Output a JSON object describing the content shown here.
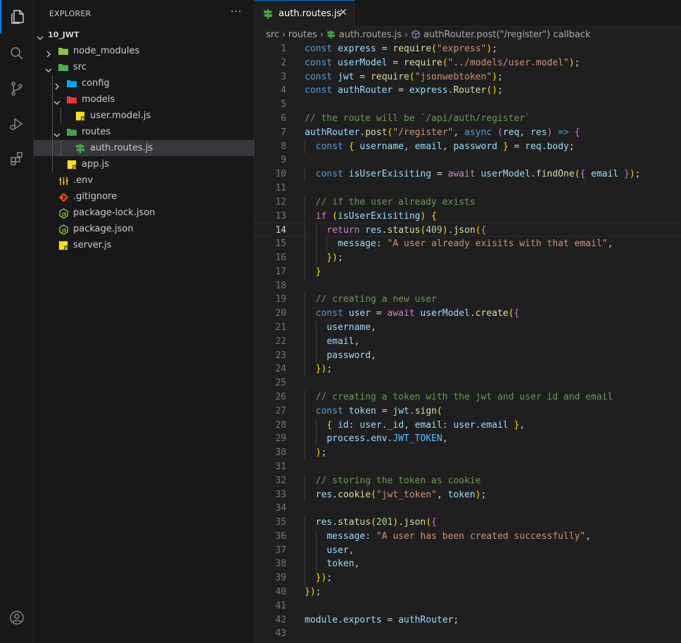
{
  "activity_bar": {
    "items": [
      {
        "name": "explorer-icon",
        "active": true
      },
      {
        "name": "search-icon",
        "active": false
      },
      {
        "name": "source-control-icon",
        "active": false
      },
      {
        "name": "run-debug-icon",
        "active": false
      },
      {
        "name": "extensions-icon",
        "active": false
      }
    ],
    "bottom": [
      {
        "name": "account-icon"
      }
    ]
  },
  "sidebar": {
    "title": "EXPLORER",
    "more": "···",
    "tree": [
      {
        "label": "10_JWT",
        "depth": 0,
        "type": "root",
        "expanded": true
      },
      {
        "label": "node_modules",
        "depth": 1,
        "type": "folder",
        "expanded": false,
        "icon": "folder-node-icon",
        "color": "#8bc34a"
      },
      {
        "label": "src",
        "depth": 1,
        "type": "folder",
        "expanded": true,
        "icon": "folder-src-icon",
        "color": "#4caf50"
      },
      {
        "label": "config",
        "depth": 2,
        "type": "folder",
        "expanded": false,
        "icon": "folder-config-icon",
        "color": "#03a9f4"
      },
      {
        "label": "models",
        "depth": 2,
        "type": "folder",
        "expanded": true,
        "icon": "folder-models-icon",
        "color": "#e53935"
      },
      {
        "label": "user.model.js",
        "depth": 3,
        "type": "file",
        "icon": "js-file-icon",
        "color": "#f7df1e"
      },
      {
        "label": "routes",
        "depth": 2,
        "type": "folder",
        "expanded": true,
        "icon": "folder-routes-icon",
        "color": "#43a047"
      },
      {
        "label": "auth.routes.js",
        "depth": 3,
        "type": "file",
        "icon": "routing-file-icon",
        "color": "#43a047",
        "selected": true
      },
      {
        "label": "app.js",
        "depth": 2,
        "type": "file",
        "icon": "js-file-icon",
        "color": "#f7df1e"
      },
      {
        "label": ".env",
        "depth": 1,
        "type": "file",
        "icon": "env-file-icon",
        "color": "#fbc02d"
      },
      {
        "label": ".gitignore",
        "depth": 1,
        "type": "file",
        "icon": "git-file-icon",
        "color": "#e64a19"
      },
      {
        "label": "package-lock.json",
        "depth": 1,
        "type": "file",
        "icon": "npm-file-icon",
        "color": "#8bc34a"
      },
      {
        "label": "package.json",
        "depth": 1,
        "type": "file",
        "icon": "npm-file-icon",
        "color": "#8bc34a"
      },
      {
        "label": "server.js",
        "depth": 1,
        "type": "file",
        "icon": "js-file-icon",
        "color": "#f7df1e"
      }
    ]
  },
  "editor": {
    "tab": {
      "label": "auth.routes.js",
      "close": "✕"
    },
    "breadcrumb": [
      "src",
      "routes",
      "auth.routes.js",
      "authRouter.post(\"/register\") callback"
    ],
    "current_line": 14,
    "lines": [
      {
        "n": "1",
        "t": "const express = require(\"express\");"
      },
      {
        "n": "2",
        "t": "const userModel = require(\"../models/user.model\");"
      },
      {
        "n": "3",
        "t": "const jwt = require(\"jsonwebtoken\");"
      },
      {
        "n": "4",
        "t": "const authRouter = express.Router();"
      },
      {
        "n": "5",
        "t": ""
      },
      {
        "n": "6",
        "t": "// the route will be `/api/auth/register`"
      },
      {
        "n": "7",
        "t": "authRouter.post(\"/register\", async (req, res) => {"
      },
      {
        "n": "8",
        "t": "  const { username, email, password } = req.body;"
      },
      {
        "n": "9",
        "t": ""
      },
      {
        "n": "10",
        "t": "  const isUserExisiting = await userModel.findOne({ email });"
      },
      {
        "n": "11",
        "t": ""
      },
      {
        "n": "12",
        "t": "  // if the user already exists"
      },
      {
        "n": "13",
        "t": "  if (isUserExisiting) {"
      },
      {
        "n": "14",
        "t": "    return res.status(409).json({"
      },
      {
        "n": "15",
        "t": "      message: \"A user already exisits with that email\","
      },
      {
        "n": "16",
        "t": "    });"
      },
      {
        "n": "17",
        "t": "  }"
      },
      {
        "n": "18",
        "t": ""
      },
      {
        "n": "19",
        "t": "  // creating a new user"
      },
      {
        "n": "20",
        "t": "  const user = await userModel.create({"
      },
      {
        "n": "21",
        "t": "    username,"
      },
      {
        "n": "22",
        "t": "    email,"
      },
      {
        "n": "23",
        "t": "    password,"
      },
      {
        "n": "24",
        "t": "  });"
      },
      {
        "n": "25",
        "t": ""
      },
      {
        "n": "26",
        "t": "  // creating a token with the jwt and user id and email"
      },
      {
        "n": "27",
        "t": "  const token = jwt.sign("
      },
      {
        "n": "28",
        "t": "    { id: user._id, email: user.email },"
      },
      {
        "n": "29",
        "t": "    process.env.JWT_TOKEN,"
      },
      {
        "n": "30",
        "t": "  );"
      },
      {
        "n": "31",
        "t": ""
      },
      {
        "n": "32",
        "t": "  // storing the token as cookie"
      },
      {
        "n": "33",
        "t": "  res.cookie(\"jwt_token\", token);"
      },
      {
        "n": "34",
        "t": ""
      },
      {
        "n": "35",
        "t": "  res.status(201).json({"
      },
      {
        "n": "36",
        "t": "    message: \"A user has been created successfully\","
      },
      {
        "n": "37",
        "t": "    user,"
      },
      {
        "n": "38",
        "t": "    token,"
      },
      {
        "n": "39",
        "t": "  });"
      },
      {
        "n": "40",
        "t": "});"
      },
      {
        "n": "41",
        "t": ""
      },
      {
        "n": "42",
        "t": "module.exports = authRouter;"
      },
      {
        "n": "43",
        "t": ""
      }
    ]
  }
}
